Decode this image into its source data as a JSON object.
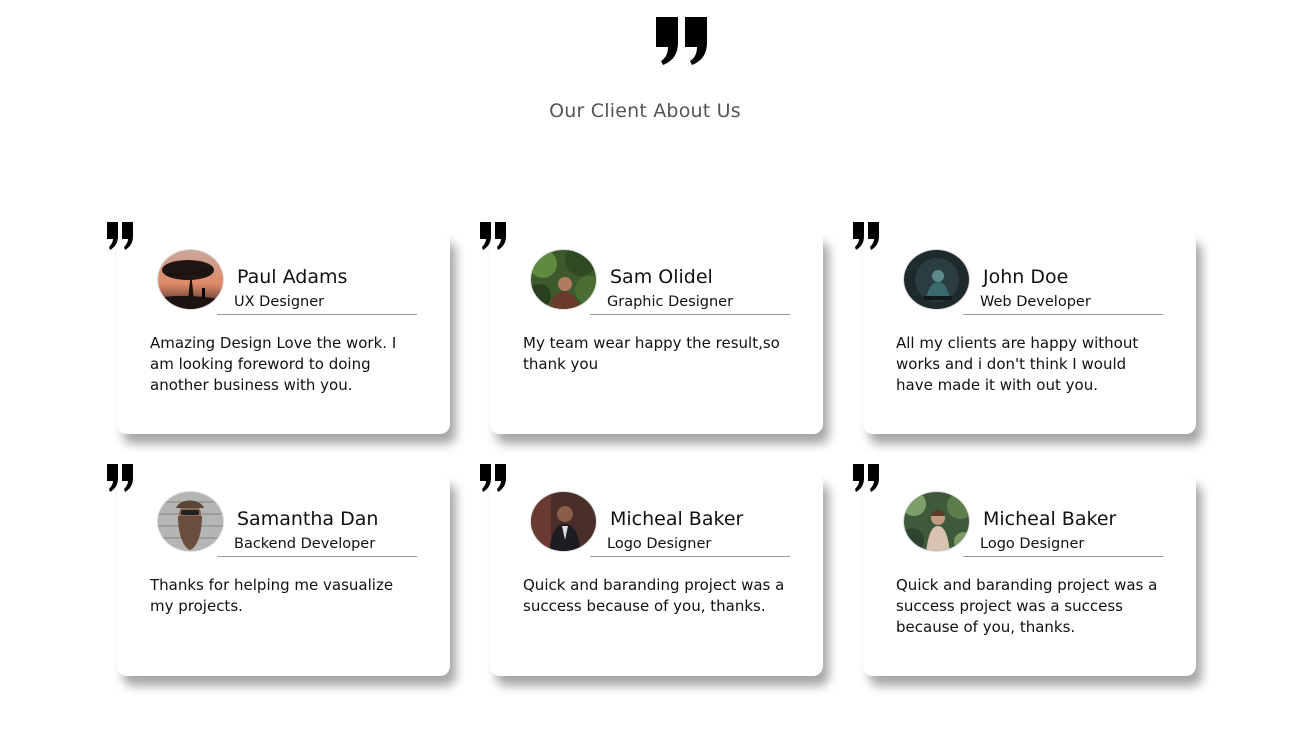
{
  "header": {
    "quote_icon": "double-quote-icon",
    "title": "Our Client About Us"
  },
  "testimonials": [
    {
      "name": "Paul Adams",
      "role": "UX Designer",
      "text": "Amazing Design Love the work. I am looking foreword to doing another business with you.",
      "avatar": "sunset-tree-photo"
    },
    {
      "name": "Sam Olidel",
      "role": "Graphic Designer",
      "text": "My team wear happy the result,so thank you",
      "avatar": "forest-person-photo"
    },
    {
      "name": "John Doe",
      "role": "Web Developer",
      "text": "All my clients are happy without works and i don't think I would have made it with out you.",
      "avatar": "dark-teal-portrait-photo"
    },
    {
      "name": "Samantha Dan",
      "role": "Backend Developer",
      "text": "Thanks for helping me vasualize my projects.",
      "avatar": "bearded-man-photo"
    },
    {
      "name": "Micheal Baker",
      "role": "Logo Designer",
      "text": "Quick and baranding project was a success because of you, thanks.",
      "avatar": "man-in-suit-photo"
    },
    {
      "name": "Micheal Baker",
      "role": "Logo Designer",
      "text": "Quick and baranding project was a success project was a success because of you, thanks.",
      "avatar": "woman-in-garden-photo"
    }
  ],
  "colors": {
    "title": "#555555",
    "card_bg": "#ffffff",
    "divider": "#9a9a9a",
    "quote": "#000000"
  }
}
